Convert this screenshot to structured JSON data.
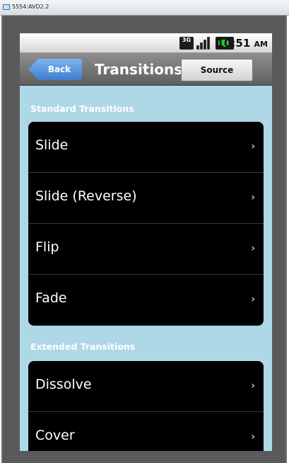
{
  "window": {
    "title": "5554:AVD2.2"
  },
  "status_bar": {
    "network": "3G",
    "time": "10:51",
    "ampm": "AM"
  },
  "nav": {
    "back_label": "Back",
    "title": "Transitions",
    "source_label": "Source"
  },
  "sections": [
    {
      "header": "Standard Transitions",
      "items": [
        {
          "label": "Slide"
        },
        {
          "label": "Slide (Reverse)"
        },
        {
          "label": "Flip"
        },
        {
          "label": "Fade"
        }
      ]
    },
    {
      "header": "Extended Transitions",
      "items": [
        {
          "label": "Dissolve"
        },
        {
          "label": "Cover"
        }
      ]
    }
  ],
  "colors": {
    "background": "#aed8e6",
    "back_button": "#4d8fdc",
    "list": "#000000"
  },
  "icons": {
    "chevron": "›",
    "window": "window-icon",
    "battery": "battery-icon",
    "signal": "signal-icon"
  }
}
